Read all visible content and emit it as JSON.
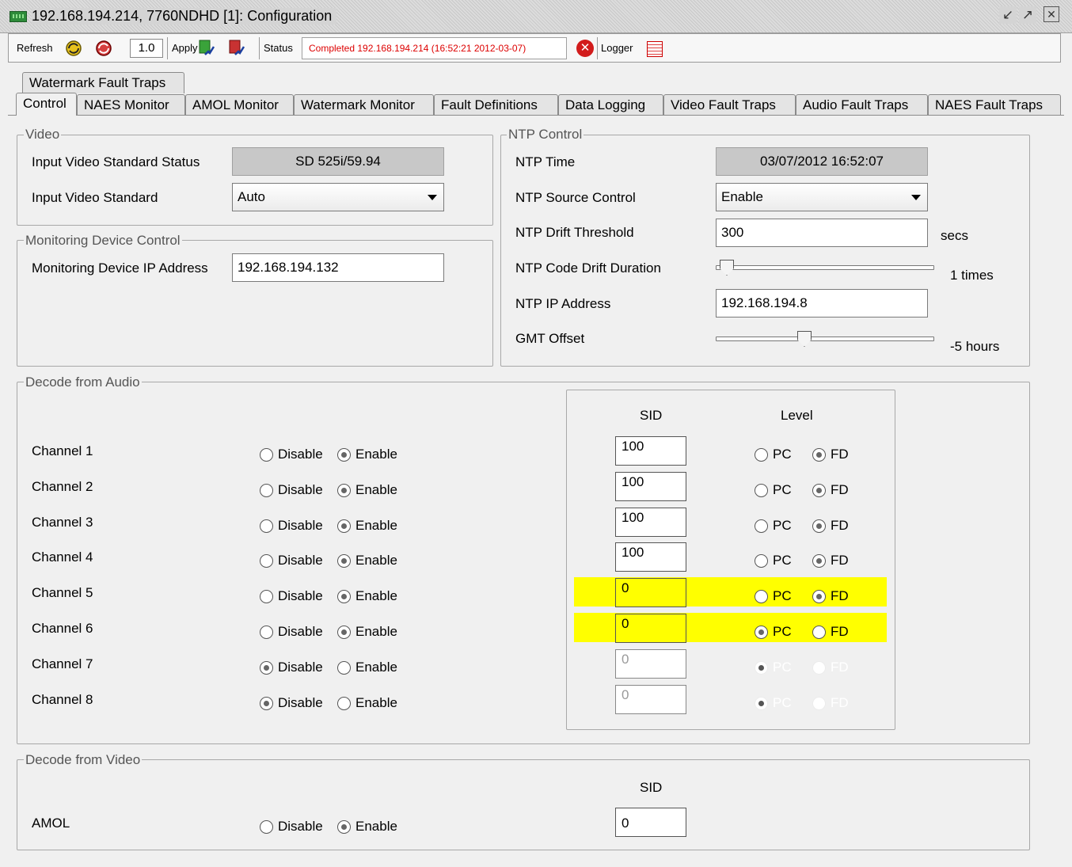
{
  "window": {
    "title": "192.168.194.214, 7760NDHD  [1]: Configuration"
  },
  "toolbar": {
    "refresh_label": "Refresh",
    "rate_value": "1.0",
    "apply_label": "Apply",
    "status_label": "Status",
    "status_text": "Completed 192.168.194.214 (16:52:21  2012-03-07)",
    "logger_label": "Logger"
  },
  "tabs": {
    "row1": [
      "Watermark Fault Traps"
    ],
    "row2": [
      "Control",
      "NAES Monitor",
      "AMOL Monitor",
      "Watermark Monitor",
      "Fault Definitions",
      "Data Logging",
      "Video Fault Traps",
      "Audio Fault Traps",
      "NAES Fault Traps"
    ],
    "active": "Control"
  },
  "video": {
    "legend": "Video",
    "status_label": "Input Video Standard Status",
    "status_value": "SD 525i/59.94",
    "standard_label": "Input Video Standard",
    "standard_value": "Auto"
  },
  "monitoring": {
    "legend": "Monitoring Device Control",
    "ip_label": "Monitoring Device IP Address",
    "ip_value": "192.168.194.132"
  },
  "ntp": {
    "legend": "NTP Control",
    "time_label": "NTP Time",
    "time_value": "03/07/2012 16:52:07",
    "source_label": "NTP Source Control",
    "source_value": "Enable",
    "drift_label": "NTP Drift Threshold",
    "drift_value": "300",
    "drift_unit": "secs",
    "duration_label": "NTP Code Drift Duration",
    "duration_value": "1 times",
    "duration_level": 0.0,
    "ip_label": "NTP IP Address",
    "ip_value": "192.168.194.8",
    "gmt_label": "GMT Offset",
    "gmt_value": "-5 hours",
    "gmt_level": 0.4
  },
  "audio": {
    "legend": "Decode from Audio",
    "sid_header": "SID",
    "level_header": "Level",
    "disable_label": "Disable",
    "enable_label": "Enable",
    "pc_label": "PC",
    "fd_label": "FD",
    "channels": [
      {
        "label": "Channel 1",
        "enabled": true,
        "sid": "100",
        "level": "FD",
        "highlight": false,
        "active": true
      },
      {
        "label": "Channel 2",
        "enabled": true,
        "sid": "100",
        "level": "FD",
        "highlight": false,
        "active": true
      },
      {
        "label": "Channel 3",
        "enabled": true,
        "sid": "100",
        "level": "FD",
        "highlight": false,
        "active": true
      },
      {
        "label": "Channel 4",
        "enabled": true,
        "sid": "100",
        "level": "FD",
        "highlight": false,
        "active": true
      },
      {
        "label": "Channel 5",
        "enabled": true,
        "sid": "0",
        "level": "FD",
        "highlight": true,
        "active": true
      },
      {
        "label": "Channel 6",
        "enabled": true,
        "sid": "0",
        "level": "PC",
        "highlight": true,
        "active": true
      },
      {
        "label": "Channel 7",
        "enabled": false,
        "sid": "0",
        "level": "PC",
        "highlight": false,
        "active": false
      },
      {
        "label": "Channel 8",
        "enabled": false,
        "sid": "0",
        "level": "PC",
        "highlight": false,
        "active": false
      }
    ]
  },
  "video_decode": {
    "legend": "Decode from Video",
    "sid_header": "SID",
    "amol_label": "AMOL",
    "amol_enabled": true,
    "amol_sid": "0"
  },
  "colors": {
    "highlight": "#ffff00",
    "status_text": "#dd0000",
    "readonly_bg": "#c8c8c8"
  }
}
